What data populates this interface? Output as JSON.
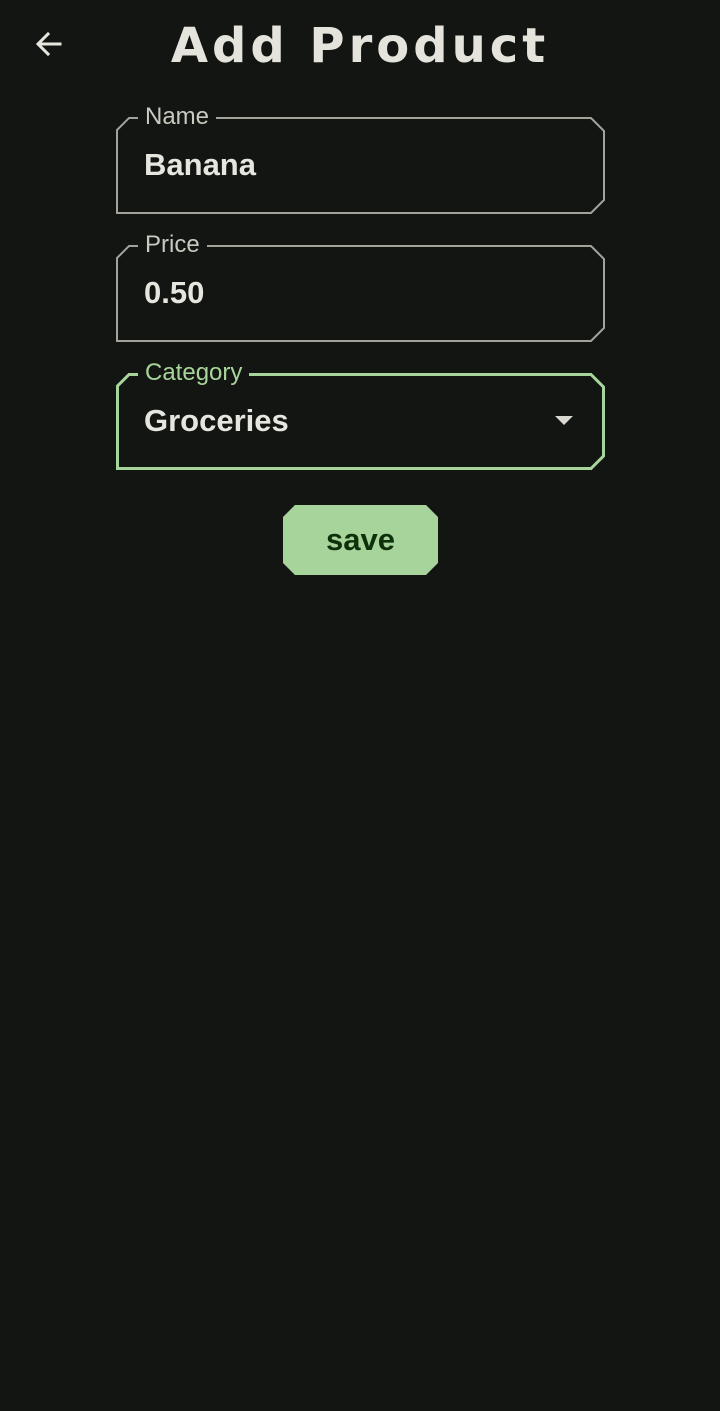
{
  "header": {
    "title": "Add Product",
    "back_icon": "arrow-left-icon"
  },
  "form": {
    "name": {
      "label": "Name",
      "value": "Banana"
    },
    "price": {
      "label": "Price",
      "value": "0.50"
    },
    "category": {
      "label": "Category",
      "value": "Groceries",
      "icon": "dropdown-arrow-icon"
    }
  },
  "actions": {
    "save_label": "save"
  },
  "colors": {
    "background": "#131512",
    "text": "#e6e6df",
    "outline": "#a3a39c",
    "accent": "#a7d49a",
    "button_text": "#0e300a"
  }
}
